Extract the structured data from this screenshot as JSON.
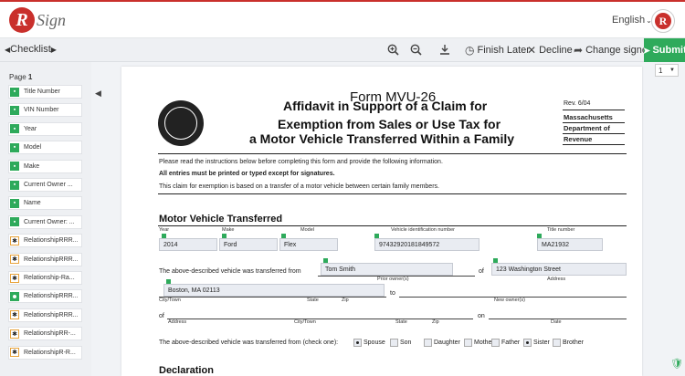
{
  "header": {
    "logo_letter": "R",
    "logo_text": "Sign",
    "language": "English",
    "avatar_letter": "R"
  },
  "toolbar": {
    "checklist_label": "Checklist",
    "zoom_in_icon": "zoom-in-icon",
    "zoom_out_icon": "zoom-out-icon",
    "download_icon": "download-icon",
    "finish_later": "Finish Later",
    "decline": "Decline",
    "change_signer": "Change signer",
    "submit": "Submit"
  },
  "sidebar": {
    "page_prefix": "Page",
    "page_number": "1",
    "fields": [
      {
        "label": "Title Number",
        "type": "text"
      },
      {
        "label": "VIN Number",
        "type": "text"
      },
      {
        "label": "Year",
        "type": "text"
      },
      {
        "label": "Model",
        "type": "text"
      },
      {
        "label": "Make",
        "type": "text"
      },
      {
        "label": "Current Owner ...",
        "type": "text"
      },
      {
        "label": "Name",
        "type": "text"
      },
      {
        "label": "Current Owner: ...",
        "type": "text"
      },
      {
        "label": "RelationshipRRR...",
        "type": "required"
      },
      {
        "label": "RelationshipRRR...",
        "type": "required"
      },
      {
        "label": "Relationship-Ra...",
        "type": "required"
      },
      {
        "label": "RelationshipRRR...",
        "type": "radio"
      },
      {
        "label": "RelationshipRRR...",
        "type": "required"
      },
      {
        "label": "RelationshipRR-...",
        "type": "required"
      },
      {
        "label": "RelationshipR-R...",
        "type": "required"
      }
    ]
  },
  "document": {
    "form_number": "Form MVU-26",
    "title_line1": "Affidavit in Support of a Claim for",
    "title_line2": "Exemption from Sales or Use Tax for",
    "title_line3": "a Motor Vehicle Transferred Within a Family",
    "rev": "Rev. 6/04",
    "state_line1": "Massachusetts",
    "state_line2": "Department of",
    "state_line3": "Revenue",
    "instruction1": "Please read the instructions below before completing this form and provide the following information.",
    "instruction2": "All entries must be printed or typed except for signatures.",
    "instruction3": "This claim for exemption is based on a transfer of a motor vehicle between certain family members.",
    "section1": "Motor Vehicle Transferred",
    "labels": {
      "year": "Year",
      "make": "Make",
      "model": "Model",
      "vin": "Vehicle identification number",
      "title_number": "Title number",
      "prior_owner": "Prior owner(s)",
      "address": "Address",
      "city_town": "City/Town",
      "state": "State",
      "zip": "Zip",
      "new_owner": "New owner(s)",
      "date": "Date"
    },
    "values": {
      "year": "2014",
      "make": "Ford",
      "model": "Flex",
      "vin": "97432920181849572",
      "title_number": "MA21932",
      "prior_owner": "Tom Smith",
      "address": "123 Washington Street",
      "city": "Boston, MA 02113"
    },
    "transfer_from_text": "The above-described vehicle was transferred from",
    "of_text": "of",
    "to_text": "to",
    "on_text": "on",
    "check_one_text": "The above-described vehicle was transferred from (check one):",
    "relations": [
      "Spouse",
      "Son",
      "Daughter",
      "Mother",
      "Father",
      "Sister",
      "Brother"
    ],
    "section2": "Declaration"
  },
  "pager": {
    "current": "1"
  }
}
